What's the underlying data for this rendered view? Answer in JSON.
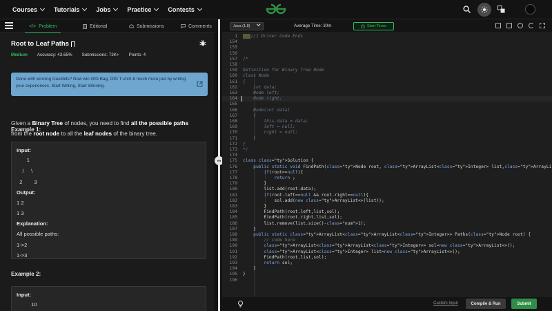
{
  "nav": {
    "items": [
      "Courses",
      "Tutorials",
      "Jobs",
      "Practice",
      "Contests"
    ]
  },
  "tabs": [
    {
      "label": "Problem",
      "icon": "code-icon"
    },
    {
      "label": "Editorial",
      "icon": "document-icon"
    },
    {
      "label": "Submissions",
      "icon": "cloud-upload-icon"
    },
    {
      "label": "Comments",
      "icon": "comment-icon"
    }
  ],
  "problem": {
    "title": "Root to Leaf Paths",
    "difficulty": "Medium",
    "accuracy_label": "Accuracy:",
    "accuracy": "43.65%",
    "submissions_label": "Submissions:",
    "submissions": "73K+",
    "points_label": "Points:",
    "points": "4",
    "banner": "Done with winning Geekbits? Now win GfG Bag, GfG T-shirt & much more just by writing your experiences. Start Writing, Start Winning.",
    "desc": {
      "p1": "Given a ",
      "b1": "Binary Tree",
      "p2": " of nodes, you need to find ",
      "b2": "all the possible paths",
      "p3": " from the ",
      "b3": "root node",
      "p4": " to all the ",
      "b4": "leaf nodes",
      "p5": " of the binary tree."
    },
    "example1_title": "Example 1:",
    "example1": {
      "input_label": "Input:",
      "tree1": "       1",
      "tree2": "    /     \\",
      "tree3": "  2        3",
      "output_label": "Output:",
      "out1": "1 2",
      "out2": "1 3",
      "explanation_label": "Explanation:",
      "exp0": "All possible paths:",
      "exp1": "1->2",
      "exp2": "1->3"
    },
    "example2_title": "Example 2:",
    "example2": {
      "input_label": "Input:",
      "tree1": "          10"
    }
  },
  "editor": {
    "language": "Java (1.8)",
    "avg_time": "Average Time: 30m",
    "timer_label": "Start Timer",
    "custom_input": "Custom Input",
    "compile": "Compile & Run",
    "submit": "Submit"
  },
  "code": [
    {
      "n": "1",
      "t": "//{ Driver Code Ends"
    },
    {
      "n": "154",
      "t": ""
    },
    {
      "n": "155",
      "t": ""
    },
    {
      "n": "156",
      "t": ""
    },
    {
      "n": "157",
      "t": "/*"
    },
    {
      "n": "158",
      "t": ""
    },
    {
      "n": "159",
      "t": "Definition for Binary Tree Node"
    },
    {
      "n": "160",
      "t": "class Node"
    },
    {
      "n": "161",
      "t": "{"
    },
    {
      "n": "162",
      "t": "    int data;"
    },
    {
      "n": "163",
      "t": "    Node left;"
    },
    {
      "n": "164",
      "t": "    Node right;"
    },
    {
      "n": "165",
      "t": ""
    },
    {
      "n": "166",
      "t": "    Node(int data)"
    },
    {
      "n": "167",
      "t": "    {"
    },
    {
      "n": "168",
      "t": "        this.data = data;"
    },
    {
      "n": "169",
      "t": "        left = null;"
    },
    {
      "n": "170",
      "t": "        right = null;"
    },
    {
      "n": "171",
      "t": "    }"
    },
    {
      "n": "172",
      "t": "}"
    },
    {
      "n": "173",
      "t": "*/"
    },
    {
      "n": "174",
      "t": ""
    },
    {
      "n": "175",
      "t": "class Solution {"
    },
    {
      "n": "176",
      "t": "    public static void FindPath(Node root, ArrayList<Integer> list,ArrayList<ArrayList<Integer>> sol){"
    },
    {
      "n": "177",
      "t": "        if(root==null){"
    },
    {
      "n": "178",
      "t": "            return ;"
    },
    {
      "n": "179",
      "t": "        }"
    },
    {
      "n": "180",
      "t": "        list.add(root.data);"
    },
    {
      "n": "181",
      "t": "        if(root.left==null && root.right==null){"
    },
    {
      "n": "182",
      "t": "            sol.add(new ArrayList<>(list));"
    },
    {
      "n": "183",
      "t": "        }"
    },
    {
      "n": "184",
      "t": "        FindPath(root.left,list,sol);"
    },
    {
      "n": "185",
      "t": "        FindPath(root.right,list,sol);"
    },
    {
      "n": "186",
      "t": "        list.remove(list.size()-1);"
    },
    {
      "n": "187",
      "t": "    }"
    },
    {
      "n": "188",
      "t": "    public static ArrayList<ArrayList<Integer>> Paths(Node root) {"
    },
    {
      "n": "189",
      "t": "        // code here"
    },
    {
      "n": "190",
      "t": "        ArrayList<ArrayList<Integer>> sol=new ArrayList<>();"
    },
    {
      "n": "191",
      "t": "        ArrayList<Integer> list=new ArrayList<>();"
    },
    {
      "n": "192",
      "t": "        FindPath(root,list,sol);"
    },
    {
      "n": "193",
      "t": "        return sol;"
    },
    {
      "n": "194",
      "t": "    }"
    },
    {
      "n": "195",
      "t": "}"
    },
    {
      "n": "196",
      "t": ""
    }
  ],
  "colors": {
    "accent": "#2fbf61",
    "banner": "#6ea6cf",
    "submit": "#2f8d46"
  }
}
